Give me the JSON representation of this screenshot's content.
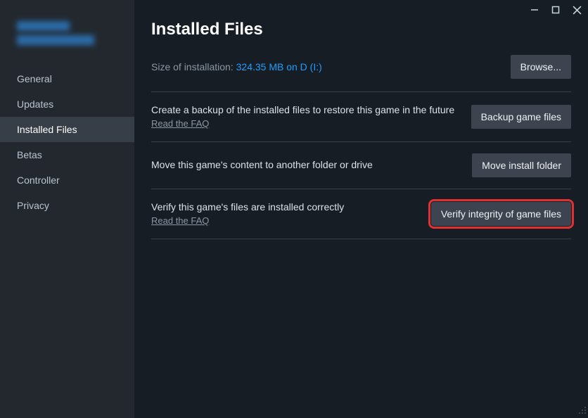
{
  "sidebar": {
    "items": [
      {
        "label": "General"
      },
      {
        "label": "Updates"
      },
      {
        "label": "Installed Files"
      },
      {
        "label": "Betas"
      },
      {
        "label": "Controller"
      },
      {
        "label": "Privacy"
      }
    ]
  },
  "main": {
    "title": "Installed Files",
    "size_label": "Size of installation: ",
    "size_value": "324.35 MB on D (I:)",
    "browse_label": "Browse...",
    "rows": [
      {
        "title": "Create a backup of the installed files to restore this game in the future",
        "link": "Read the FAQ",
        "button": "Backup game files"
      },
      {
        "title": "Move this game's content to another folder or drive",
        "link": "",
        "button": "Move install folder"
      },
      {
        "title": "Verify this game's files are installed correctly",
        "link": "Read the FAQ",
        "button": "Verify integrity of game files"
      }
    ]
  }
}
